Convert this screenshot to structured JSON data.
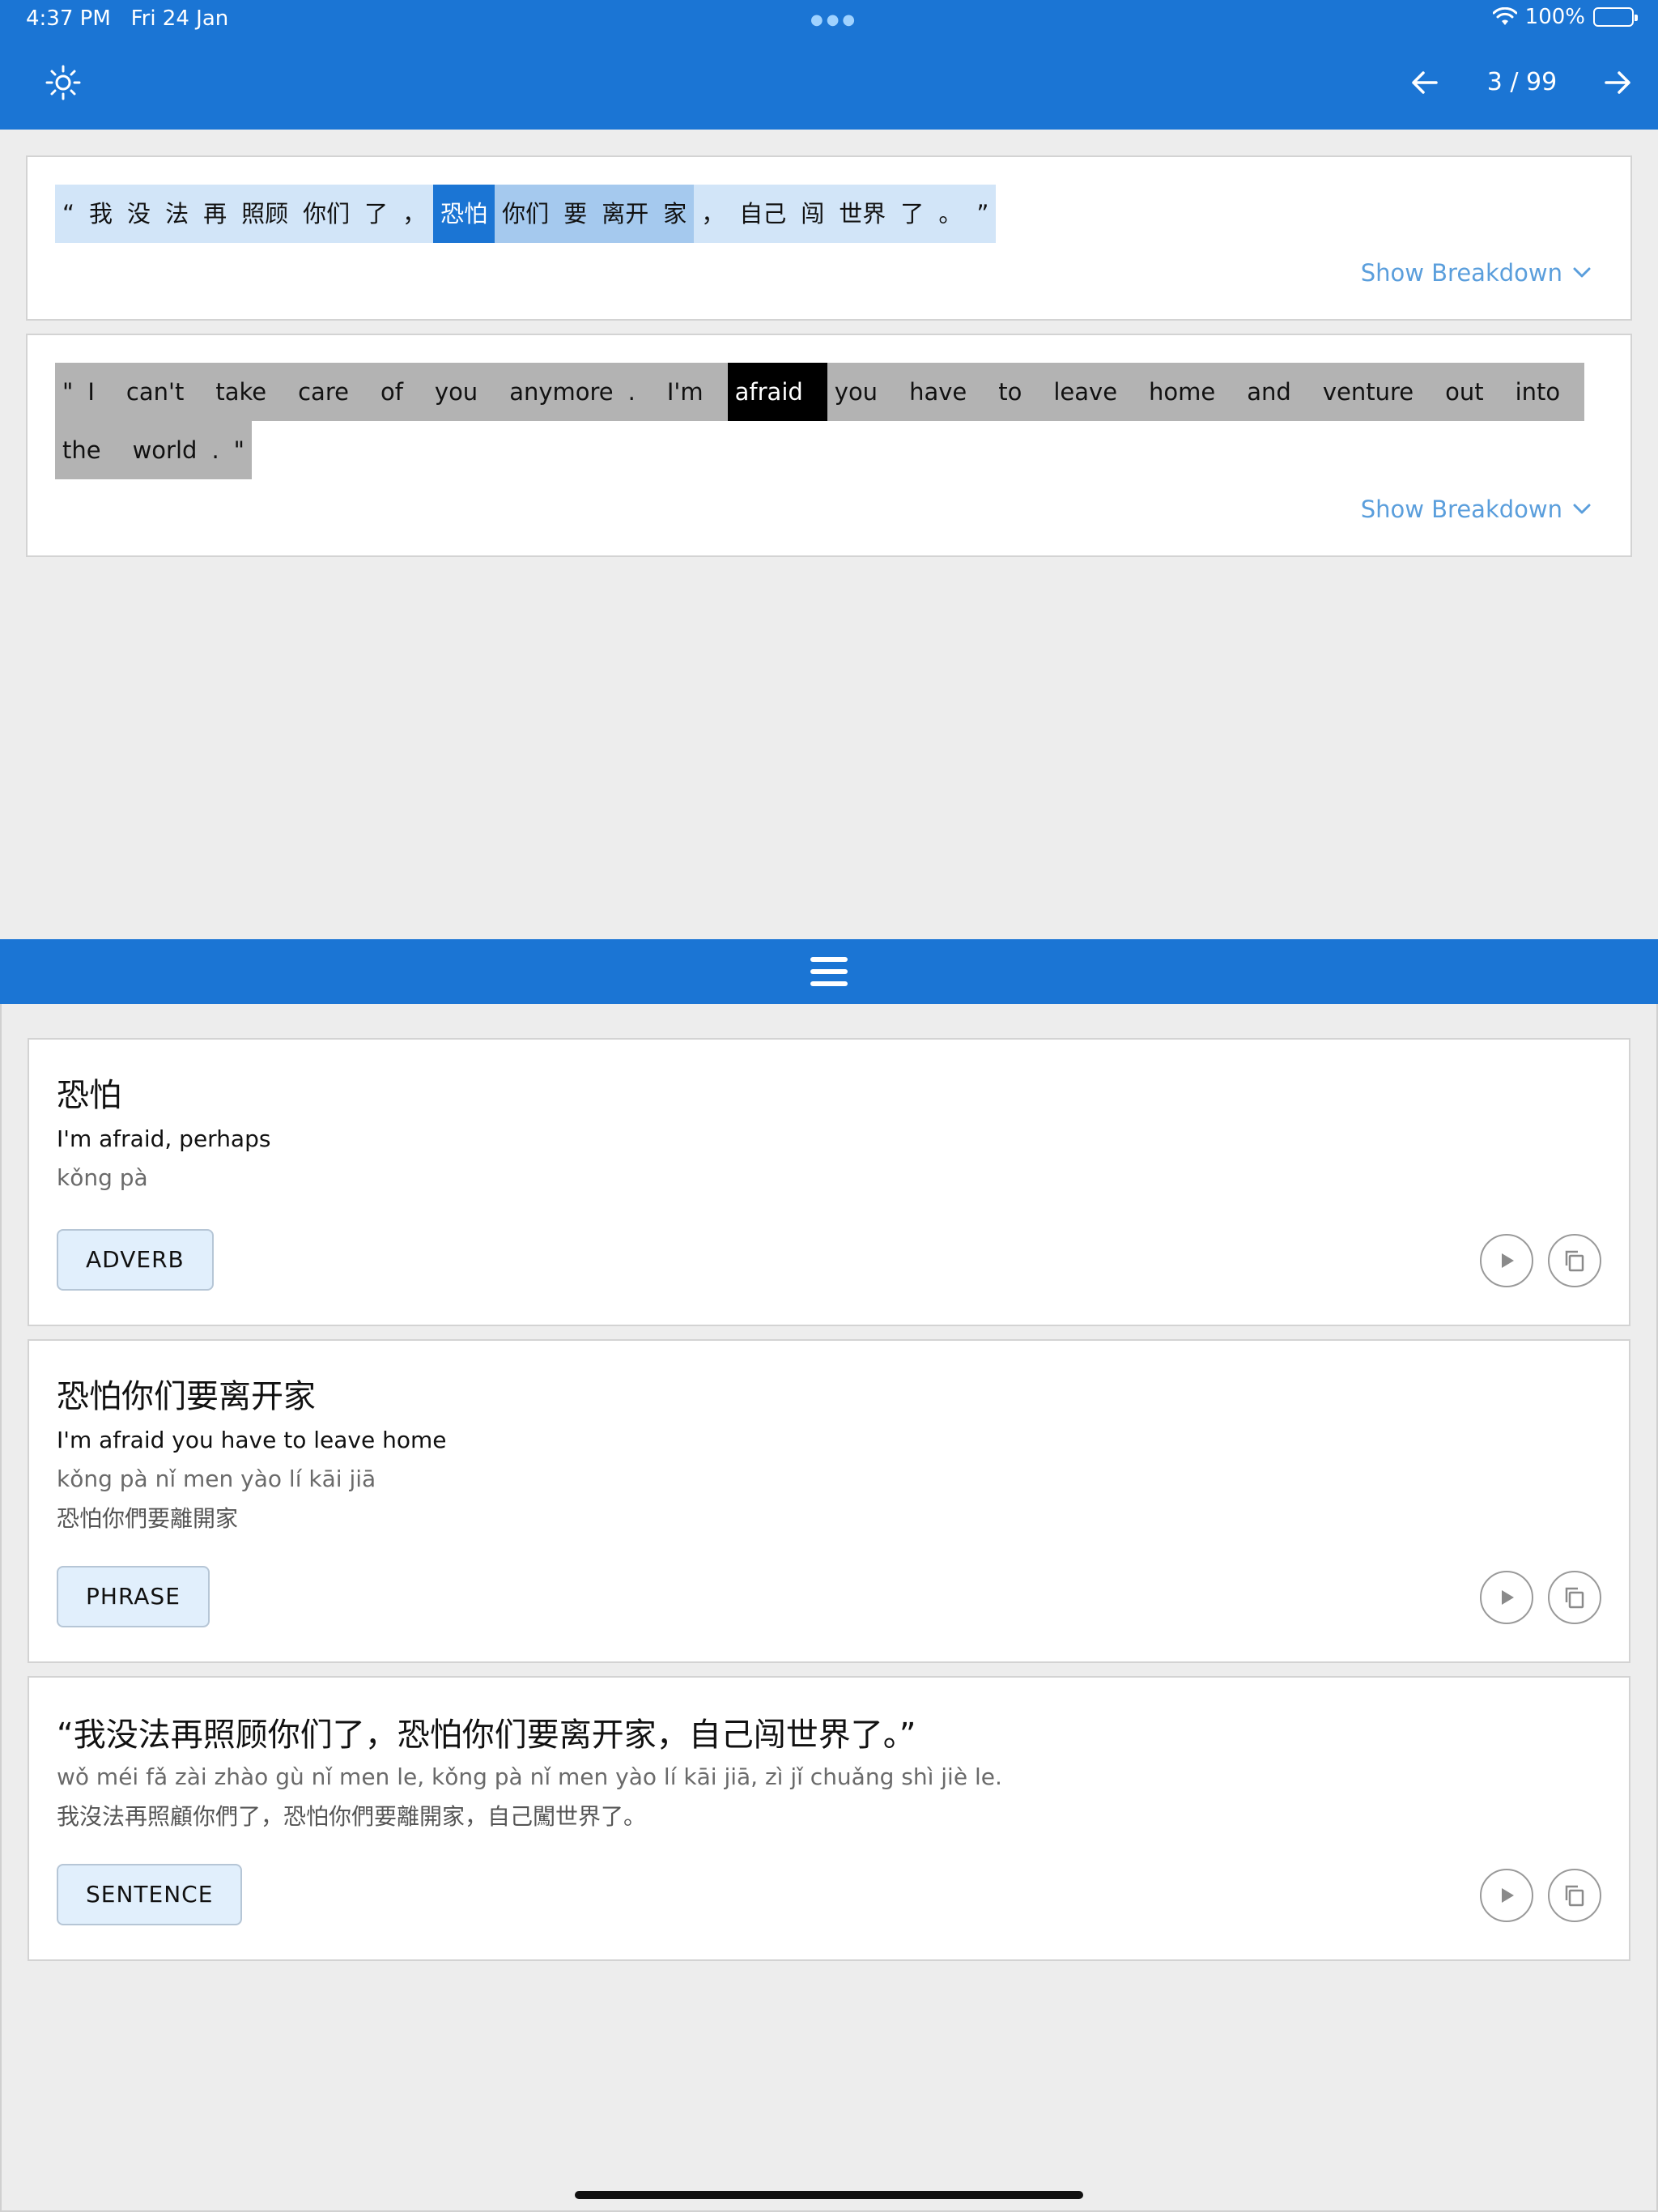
{
  "status_bar": {
    "time": "4:37 PM",
    "date": "Fri 24 Jan",
    "battery": "100%"
  },
  "toolbar": {
    "page_counter": "3 / 99"
  },
  "colors": {
    "primary": "#1b75d4",
    "link": "#5a9edc",
    "chinese_token": "#d2e5f8",
    "english_token": "#b3b3b3"
  },
  "icons": {
    "brightness": "brightness-icon",
    "previous": "arrow-left-icon",
    "next": "arrow-right-icon",
    "menu": "hamburger-menu-icon",
    "play": "play-icon",
    "copy": "copy-icon"
  },
  "chinese_sentence": {
    "tokens": [
      "“",
      "我",
      "没",
      "法",
      "再",
      "照顾",
      "你们",
      "了",
      "，",
      "恐怕",
      "你们",
      "要",
      "离开",
      "家",
      "，",
      "自己",
      "闯",
      "世界",
      "了",
      "。",
      "”"
    ],
    "breakdown_label": "Show Breakdown"
  },
  "english_sentence": {
    "tokens": [
      "\"",
      "I",
      "can't",
      "take",
      "care",
      "of",
      "you",
      "anymore",
      ".",
      "I'm",
      "afraid",
      "you",
      "have",
      "to",
      "leave",
      "home",
      "and",
      "venture",
      "out",
      "into",
      "the",
      "world",
      ".",
      "\""
    ],
    "breakdown_label": "Show Breakdown"
  },
  "entries": [
    {
      "headword": "恐怕",
      "meaning": "I'm afraid, perhaps",
      "pinyin": "kǒng pà",
      "traditional": "",
      "tag": "ADVERB"
    },
    {
      "headword": "恐怕你们要离开家",
      "meaning": "I'm afraid you have to leave home",
      "pinyin": "kǒng pà nǐ men yào lí kāi jiā",
      "traditional": "恐怕你們要離開家",
      "tag": "PHRASE"
    },
    {
      "headword": "“我没法再照顾你们了，恐怕你们要离开家，自己闯世界了。”",
      "meaning": "",
      "pinyin": "wǒ méi fǎ zài zhào gù nǐ men le, kǒng pà nǐ men yào lí kāi jiā, zì jǐ chuǎng shì jiè le.",
      "traditional": "我沒法再照顧你們了，恐怕你們要離開家，自己闖世界了。",
      "tag": "SENTENCE"
    }
  ]
}
